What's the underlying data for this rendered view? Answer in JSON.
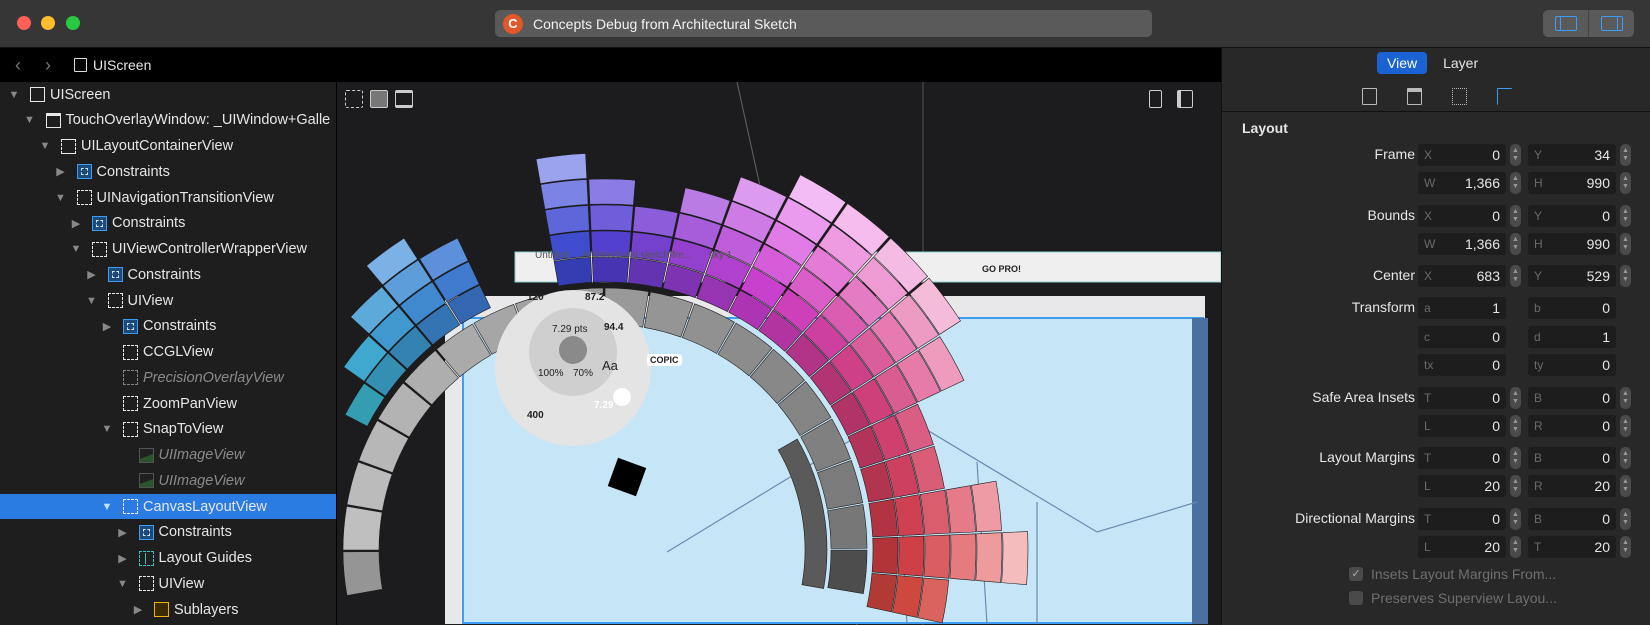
{
  "window": {
    "title": "Concepts Debug from Architectural Sketch",
    "app_icon": "C",
    "traffic_lights": {
      "close": "#ff5f57",
      "minimize": "#febc2e",
      "zoom": "#28c840"
    }
  },
  "breadcrumb": {
    "back": "‹",
    "forward": "›",
    "item": "UIScreen"
  },
  "tree": [
    {
      "label": "UIScreen",
      "level": 0,
      "arrow": "down",
      "icon": "screen"
    },
    {
      "label": "TouchOverlayWindow: _UIWindow+Galle",
      "level": 1,
      "arrow": "down",
      "icon": "window"
    },
    {
      "label": "UILayoutContainerView",
      "level": 2,
      "arrow": "down",
      "icon": "container"
    },
    {
      "label": "Constraints",
      "level": 3,
      "arrow": "right",
      "icon": "constraints"
    },
    {
      "label": "UINavigationTransitionView",
      "level": 3,
      "arrow": "down",
      "icon": "view"
    },
    {
      "label": "Constraints",
      "level": 4,
      "arrow": "right",
      "icon": "constraints"
    },
    {
      "label": "UIViewControllerWrapperView",
      "level": 4,
      "arrow": "down",
      "icon": "view"
    },
    {
      "label": "Constraints",
      "level": 5,
      "arrow": "right",
      "icon": "constraints"
    },
    {
      "label": "UIView",
      "level": 5,
      "arrow": "down",
      "icon": "view"
    },
    {
      "label": "Constraints",
      "level": 6,
      "arrow": "right",
      "icon": "constraints"
    },
    {
      "label": "CCGLView",
      "level": 6,
      "arrow": "none",
      "icon": "view"
    },
    {
      "label": "PrecisionOverlayView",
      "level": 6,
      "arrow": "none",
      "icon": "view",
      "hidden": true
    },
    {
      "label": "ZoomPanView",
      "level": 6,
      "arrow": "none",
      "icon": "view"
    },
    {
      "label": "SnapToView",
      "level": 6,
      "arrow": "down",
      "icon": "view"
    },
    {
      "label": "UIImageView",
      "level": 7,
      "arrow": "none",
      "icon": "image",
      "hidden": true
    },
    {
      "label": "UIImageView",
      "level": 7,
      "arrow": "none",
      "icon": "image",
      "hidden": true
    },
    {
      "label": "CanvasLayoutView",
      "level": 6,
      "arrow": "down",
      "icon": "view",
      "selected": true
    },
    {
      "label": "Constraints",
      "level": 7,
      "arrow": "right",
      "icon": "constraints"
    },
    {
      "label": "Layout Guides",
      "level": 7,
      "arrow": "right",
      "icon": "guides"
    },
    {
      "label": "UIView",
      "level": 7,
      "arrow": "down",
      "icon": "view"
    },
    {
      "label": "Sublayers",
      "level": 8,
      "arrow": "right",
      "icon": "layers"
    }
  ],
  "canvas": {
    "doc_title": "Untitled",
    "doc_path": "Architectural sketch fre...",
    "layer": "sky 1",
    "go_pro": "GO PRO!",
    "palette_brand": "COPIC",
    "brush_size": "7.29 pts",
    "opacity": "100%",
    "smoothing": "70%",
    "tool_values": [
      "120",
      "87.2",
      "94.4",
      "400",
      "7.29"
    ],
    "text_tool": "Aa"
  },
  "inspector": {
    "tabs": [
      {
        "label": "View",
        "active": true
      },
      {
        "label": "Layer",
        "active": false
      }
    ],
    "section": "Layout",
    "properties": [
      {
        "label": "Frame",
        "rows": [
          [
            {
              "k": "X",
              "v": "0"
            },
            {
              "k": "Y",
              "v": "34"
            }
          ],
          [
            {
              "k": "W",
              "v": "1,366"
            },
            {
              "k": "H",
              "v": "990"
            }
          ]
        ],
        "stepper": true
      },
      {
        "label": "Bounds",
        "rows": [
          [
            {
              "k": "X",
              "v": "0"
            },
            {
              "k": "Y",
              "v": "0"
            }
          ],
          [
            {
              "k": "W",
              "v": "1,366"
            },
            {
              "k": "H",
              "v": "990"
            }
          ]
        ],
        "stepper": true
      },
      {
        "label": "Center",
        "rows": [
          [
            {
              "k": "X",
              "v": "683"
            },
            {
              "k": "Y",
              "v": "529"
            }
          ]
        ],
        "stepper": true
      },
      {
        "label": "Transform",
        "rows": [
          [
            {
              "k": "a",
              "v": "1"
            },
            {
              "k": "b",
              "v": "0"
            }
          ],
          [
            {
              "k": "c",
              "v": "0"
            },
            {
              "k": "d",
              "v": "1"
            }
          ],
          [
            {
              "k": "tx",
              "v": "0"
            },
            {
              "k": "ty",
              "v": "0"
            }
          ]
        ],
        "stepper": false
      },
      {
        "label": "Safe Area Insets",
        "rows": [
          [
            {
              "k": "T",
              "v": "0"
            },
            {
              "k": "B",
              "v": "0"
            }
          ],
          [
            {
              "k": "L",
              "v": "0"
            },
            {
              "k": "R",
              "v": "0"
            }
          ]
        ],
        "stepper": true
      },
      {
        "label": "Layout Margins",
        "rows": [
          [
            {
              "k": "T",
              "v": "0"
            },
            {
              "k": "B",
              "v": "0"
            }
          ],
          [
            {
              "k": "L",
              "v": "20"
            },
            {
              "k": "R",
              "v": "20"
            }
          ]
        ],
        "stepper": true
      },
      {
        "label": "Directional Margins",
        "rows": [
          [
            {
              "k": "T",
              "v": "0"
            },
            {
              "k": "B",
              "v": "0"
            }
          ],
          [
            {
              "k": "L",
              "v": "20"
            },
            {
              "k": "T",
              "v": "20"
            }
          ]
        ],
        "stepper": true
      }
    ],
    "checkboxes": [
      {
        "label": "Insets Layout Margins From...",
        "checked": true
      },
      {
        "label": "Preserves Superview Layou...",
        "checked": false
      }
    ]
  }
}
